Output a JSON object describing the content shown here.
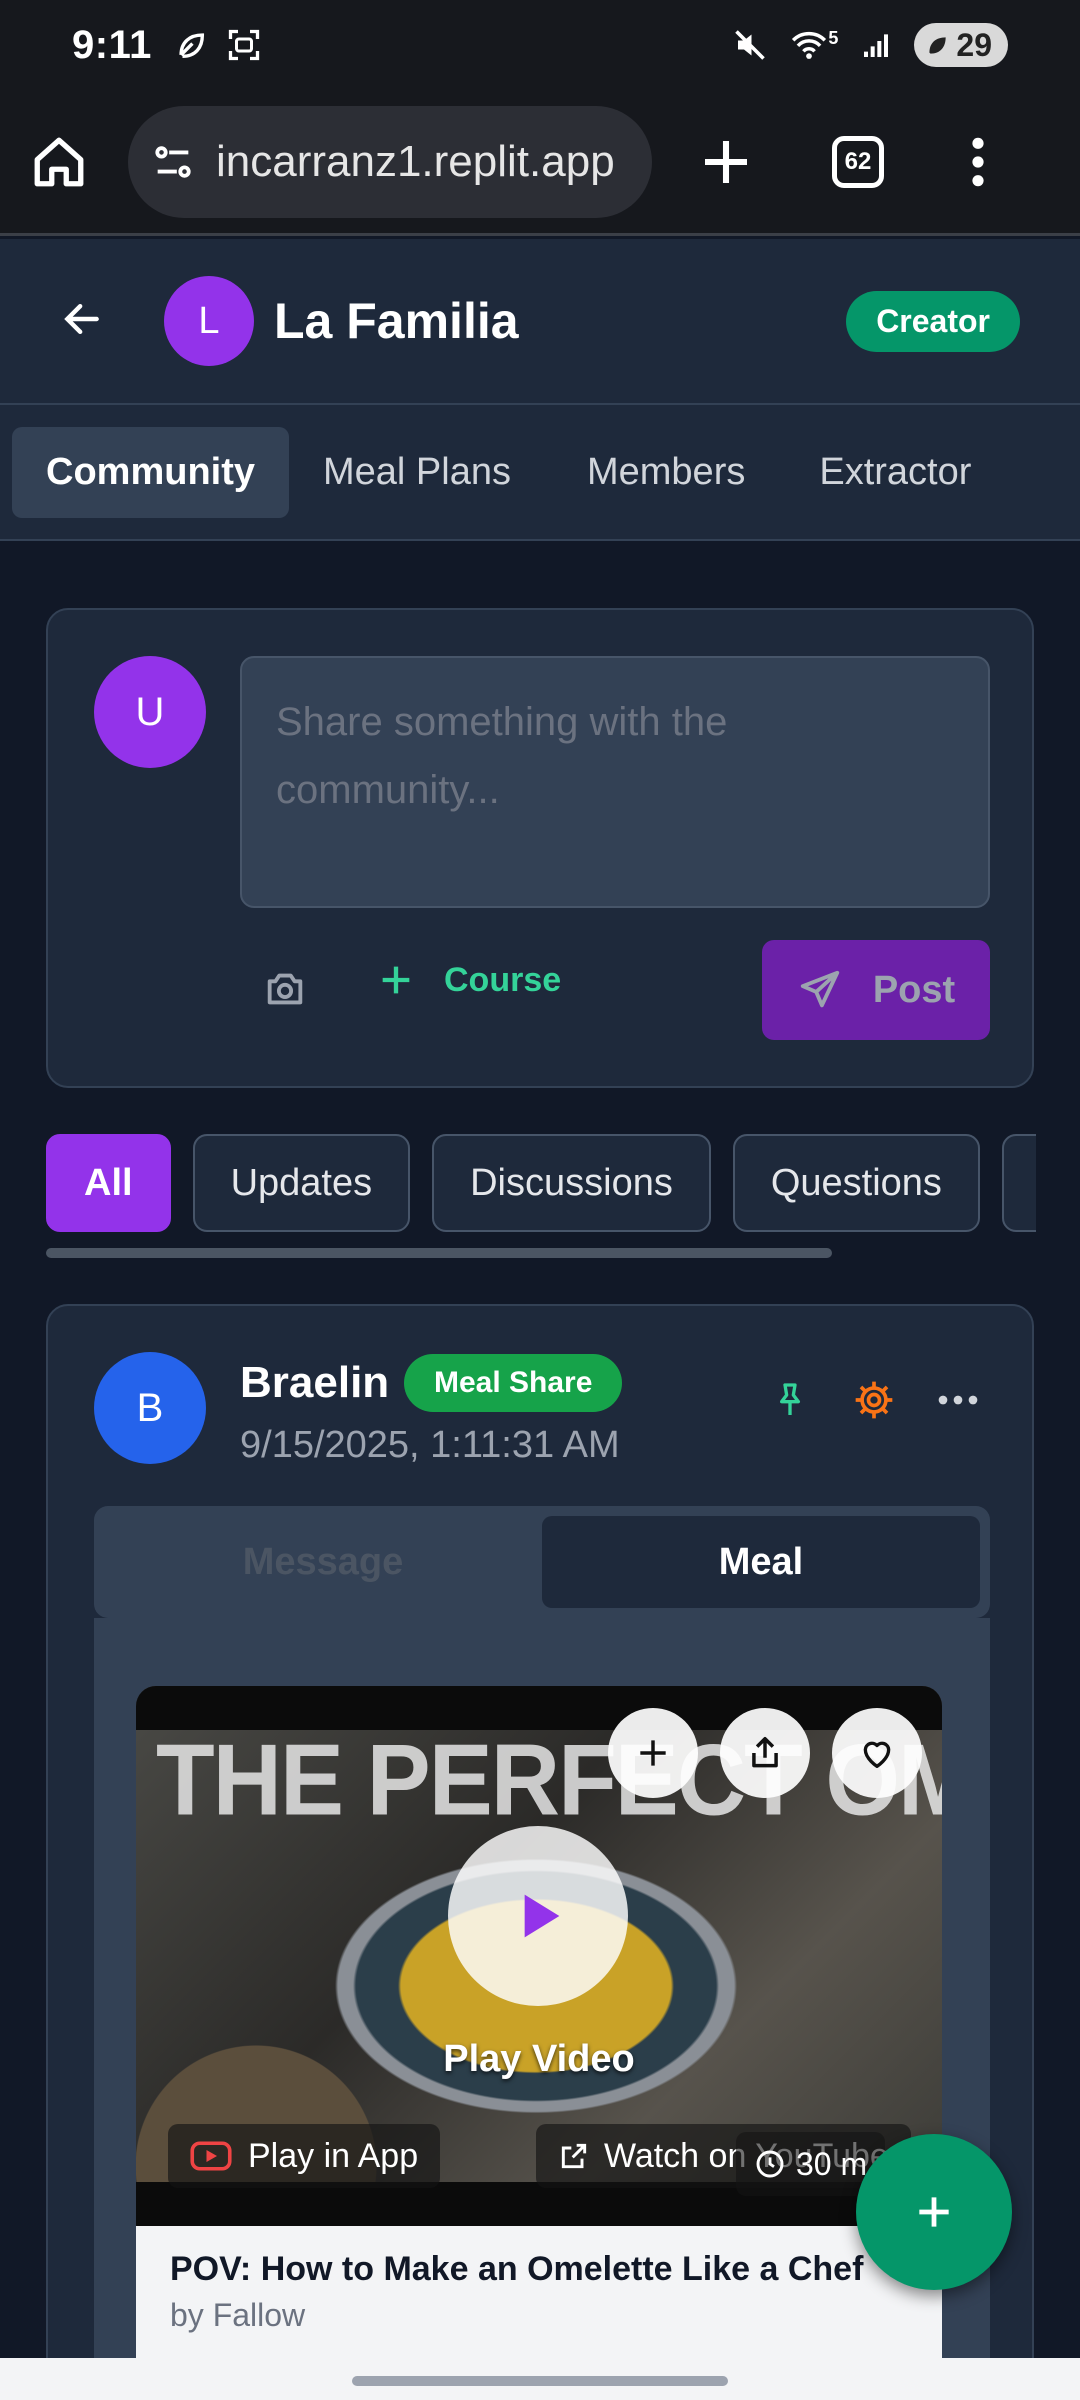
{
  "status_bar": {
    "time": "9:11",
    "battery": "29",
    "signal": "5"
  },
  "browser": {
    "url": "incarranz1.replit.app",
    "tab_count": "62"
  },
  "header": {
    "group_initial": "L",
    "group_name": "La Familia",
    "role_badge": "Creator"
  },
  "tabs": [
    {
      "label": "Community",
      "active": true
    },
    {
      "label": "Meal Plans",
      "active": false
    },
    {
      "label": "Members",
      "active": false
    },
    {
      "label": "Extractor",
      "active": false
    }
  ],
  "composer": {
    "user_initial": "U",
    "placeholder": "Share something with the community...",
    "course_label": "Course",
    "post_label": "Post"
  },
  "filters": [
    {
      "label": "All",
      "active": true
    },
    {
      "label": "Updates",
      "active": false
    },
    {
      "label": "Discussions",
      "active": false
    },
    {
      "label": "Questions",
      "active": false
    }
  ],
  "post": {
    "author_initial": "B",
    "author": "Braelin",
    "badge": "Meal Share",
    "timestamp": "9/15/2025, 1:11:31 AM",
    "segments": [
      {
        "label": "Message",
        "active": false
      },
      {
        "label": "Meal",
        "active": true
      }
    ],
    "video": {
      "overlay_title": "THE PERFECT OMELETTE",
      "play_label": "Play Video",
      "play_in_app": "Play in App",
      "watch_youtube": "Watch on YouTube",
      "duration": "30 m"
    },
    "recipe": {
      "title": "POV: How to Make an Omelette Like a Chef",
      "by": "by Fallow"
    }
  },
  "colors": {
    "accent_purple": "#9333ea",
    "accent_green": "#059669",
    "bg": "#111827",
    "card": "#1e293b"
  }
}
